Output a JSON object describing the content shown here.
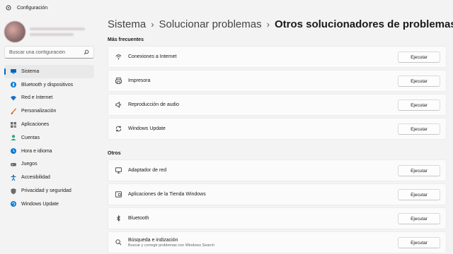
{
  "window": {
    "title": "Configuración"
  },
  "search": {
    "placeholder": "Buscar una configuración",
    "icon": "search-icon"
  },
  "sidebar": {
    "items": [
      {
        "label": "Sistema",
        "icon": "monitor-icon",
        "active": true,
        "color": "#0067c0"
      },
      {
        "label": "Bluetooth y dispositivos",
        "icon": "bluetooth-icon",
        "color": "#0078d4"
      },
      {
        "label": "Red e Internet",
        "icon": "wifi-icon",
        "color": "#1b6ec2"
      },
      {
        "label": "Personalización",
        "icon": "brush-icon",
        "color": "#e0782a"
      },
      {
        "label": "Aplicaciones",
        "icon": "apps-icon",
        "color": "#6b6b6b"
      },
      {
        "label": "Cuentas",
        "icon": "person-icon",
        "color": "#2aa372"
      },
      {
        "label": "Hora e idioma",
        "icon": "globe-clock-icon",
        "color": "#0a7bd1"
      },
      {
        "label": "Juegos",
        "icon": "gamepad-icon",
        "color": "#6b6b6b"
      },
      {
        "label": "Accesibilidad",
        "icon": "accessibility-icon",
        "color": "#0a5ea8"
      },
      {
        "label": "Privacidad y seguridad",
        "icon": "shield-icon",
        "color": "#6b6b6b"
      },
      {
        "label": "Windows Update",
        "icon": "windows-update-icon",
        "color": "#0a7bd1"
      }
    ]
  },
  "breadcrumb": {
    "level1": "Sistema",
    "level2": "Solucionar problemas",
    "current": "Otros solucionadores de problemas"
  },
  "sections": {
    "frequent": {
      "label": "Más frecuentes",
      "items": [
        {
          "title": "Conexiones a Internet",
          "icon": "wifi-icon",
          "button": "Ejecutar"
        },
        {
          "title": "Impresora",
          "icon": "printer-icon",
          "button": "Ejecutar"
        },
        {
          "title": "Reproducción de audio",
          "icon": "speaker-icon",
          "button": "Ejecutar"
        },
        {
          "title": "Windows Update",
          "icon": "refresh-icon",
          "button": "Ejecutar"
        }
      ]
    },
    "others": {
      "label": "Otros",
      "items": [
        {
          "title": "Adaptador de red",
          "icon": "network-adapter-icon",
          "button": "Ejecutar"
        },
        {
          "title": "Aplicaciones de la Tienda Windows",
          "icon": "store-apps-icon",
          "button": "Ejecutar"
        },
        {
          "title": "Bluetooth",
          "icon": "bluetooth-icon",
          "button": "Ejecutar"
        },
        {
          "title": "Búsqueda e indización",
          "subtitle": "Buscar y corregir problemas con Windows Search",
          "icon": "search-icon",
          "button": "Ejecutar"
        }
      ]
    }
  }
}
